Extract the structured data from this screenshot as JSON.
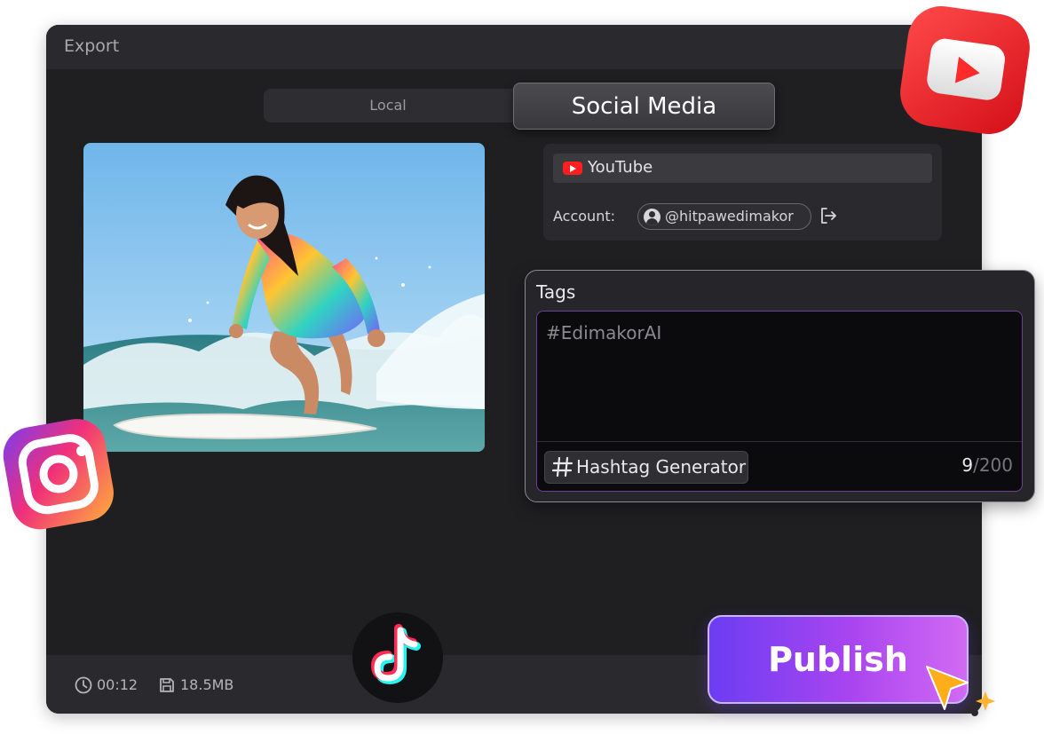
{
  "window": {
    "title": "Export"
  },
  "tabs": {
    "local_label": "Local",
    "social_label": "Social Media"
  },
  "platform": {
    "name": "YouTube",
    "account_label": "Account:",
    "account_handle": "@hitpawedimakor"
  },
  "tags": {
    "title": "Tags",
    "value": "#EdimakorAI",
    "generator_label": "Hashtag Generator",
    "count": "9",
    "max": "/200"
  },
  "footer": {
    "duration": "00:12",
    "file_size": "18.5MB"
  },
  "publish": {
    "label": "Publish"
  },
  "icons": {
    "platform_icon": "youtube-icon",
    "avatar": "user-avatar-icon",
    "logout": "logout-icon",
    "hashtag": "hashtag-icon",
    "duration": "clock-icon",
    "size": "save-disk-icon",
    "cursor": "cursor-icon",
    "floating_logos": [
      "youtube-logo",
      "instagram-logo",
      "tiktok-logo"
    ]
  },
  "colors": {
    "window_bg": "#1f1f22",
    "accent_purple": "#a945f0",
    "youtube_red": "#ff1f1f"
  }
}
